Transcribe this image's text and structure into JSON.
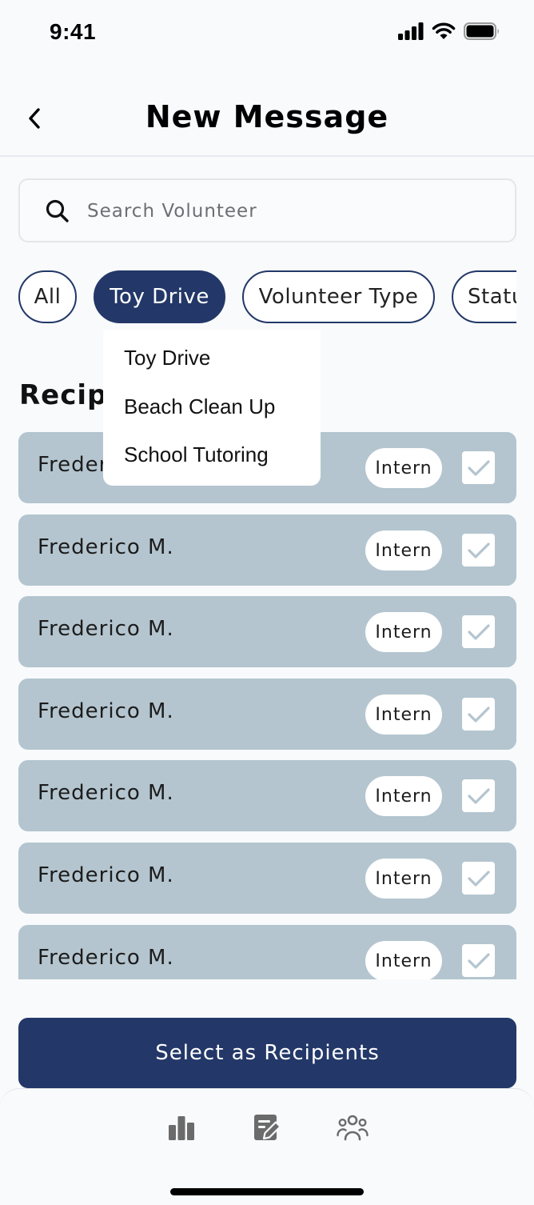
{
  "status_bar": {
    "time": "9:41"
  },
  "header": {
    "title": "New Message"
  },
  "search": {
    "placeholder": "Search Volunteer"
  },
  "filters": {
    "chips": [
      "All",
      "Toy Drive",
      "Volunteer Type",
      "Status"
    ],
    "active": "Toy Drive"
  },
  "dropdown": {
    "items": [
      "Toy Drive",
      "Beach Clean Up",
      "School Tutoring"
    ]
  },
  "recipients": {
    "title": "Recipients",
    "rows": [
      {
        "name": "Frederico M.",
        "badge": "Intern",
        "checked": true
      },
      {
        "name": "Frederico M.",
        "badge": "Intern",
        "checked": true
      },
      {
        "name": "Frederico M.",
        "badge": "Intern",
        "checked": true
      },
      {
        "name": "Frederico M.",
        "badge": "Intern",
        "checked": true
      },
      {
        "name": "Frederico M.",
        "badge": "Intern",
        "checked": true
      },
      {
        "name": "Frederico M.",
        "badge": "Intern",
        "checked": true
      },
      {
        "name": "Frederico M.",
        "badge": "Intern",
        "checked": true
      }
    ]
  },
  "cta": {
    "label": "Select as Recipients"
  },
  "tabbar": {
    "tabs": [
      "chart-icon",
      "edit-note-icon",
      "people-icon"
    ]
  },
  "colors": {
    "primary": "#233868",
    "row_bg": "#b4c5cf",
    "check": "#b4c5cf"
  }
}
